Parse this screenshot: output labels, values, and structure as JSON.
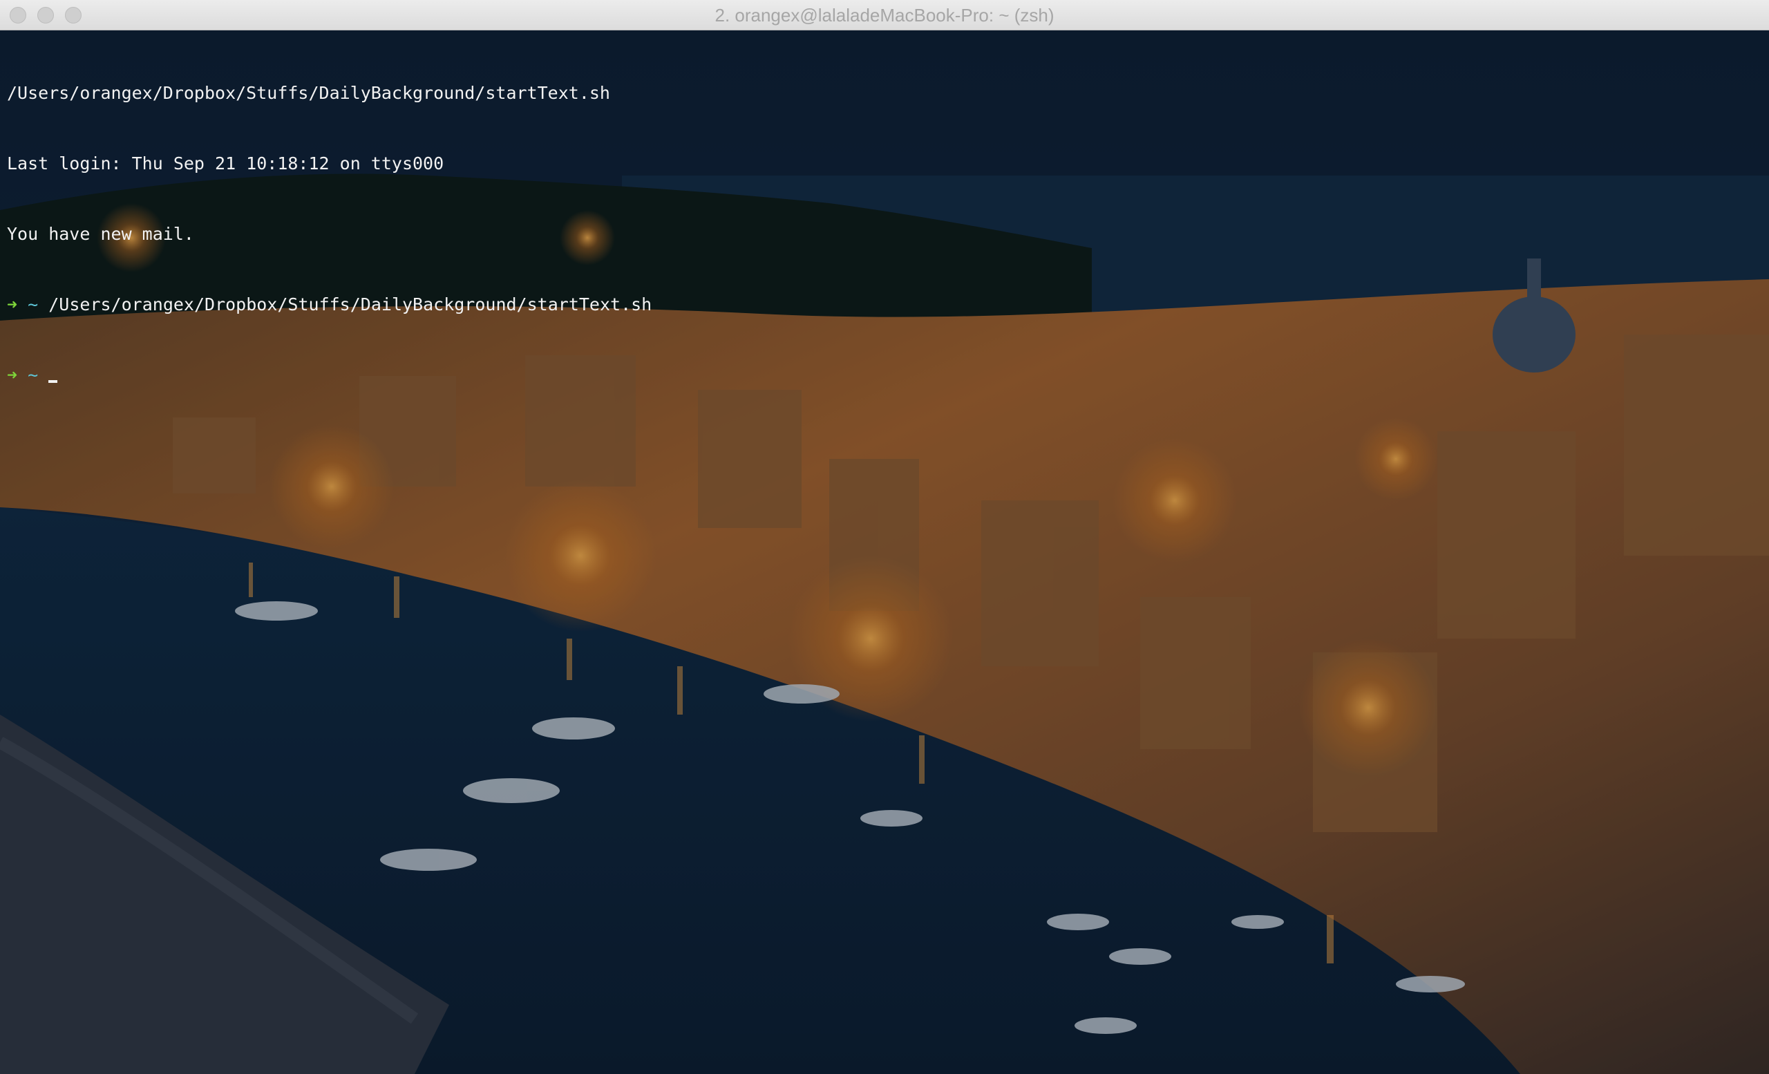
{
  "window": {
    "title": "2. orangex@lalaladeMacBook-Pro: ~ (zsh)"
  },
  "terminal": {
    "lines": [
      "/Users/orangex/Dropbox/Stuffs/DailyBackground/startText.sh",
      "Last login: Thu Sep 21 10:18:12 on ttys000",
      "You have new mail."
    ],
    "prompts": [
      {
        "arrow": "➜",
        "dir": "~",
        "command": "/Users/orangex/Dropbox/Stuffs/DailyBackground/startText.sh"
      },
      {
        "arrow": "➜",
        "dir": "~",
        "command": ""
      }
    ]
  },
  "colors": {
    "prompt_arrow": "#7ed43a",
    "prompt_dir": "#5ec7d9",
    "text": "#f2f2f2"
  },
  "icons": {
    "close": "close-button-circle",
    "minimize": "minimize-button-circle",
    "zoom": "zoom-button-circle"
  }
}
